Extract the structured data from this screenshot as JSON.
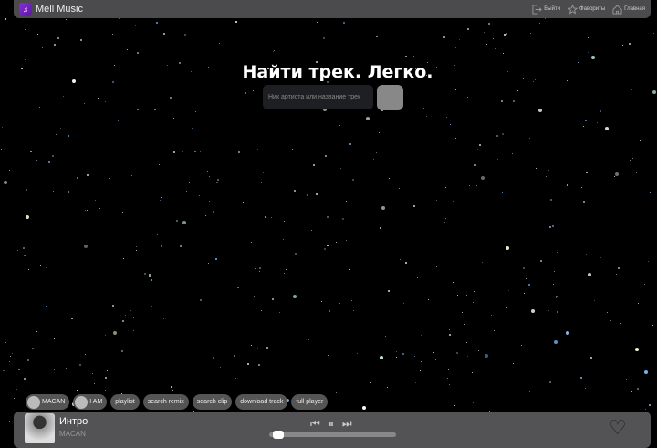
{
  "header": {
    "brand": "Mell Music",
    "nav": [
      {
        "label": "Выйти",
        "icon": "logout-icon"
      },
      {
        "label": "Фавориты",
        "icon": "star-icon"
      },
      {
        "label": "Главная",
        "icon": "home-icon"
      }
    ]
  },
  "hero": {
    "title": "Найти трек. Легко.",
    "search_placeholder": "Ник артиста или название трек"
  },
  "chips": [
    {
      "label": "MACAN",
      "avatar": true
    },
    {
      "label": "I AM",
      "avatar": true
    },
    {
      "label": "playlist"
    },
    {
      "label": "search remix"
    },
    {
      "label": "search clip"
    },
    {
      "label": "download track"
    },
    {
      "label": "full player"
    }
  ],
  "player": {
    "track": "Интро",
    "artist": "MACAN",
    "progress": 0.03
  }
}
